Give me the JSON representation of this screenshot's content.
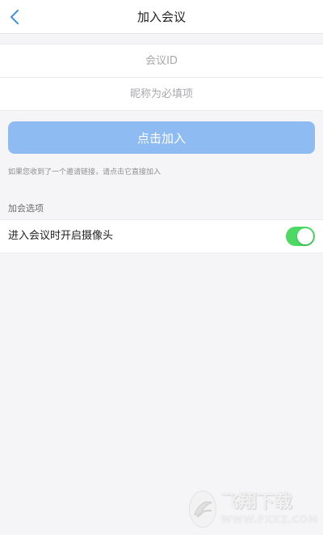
{
  "header": {
    "title": "加入会议",
    "back_icon": "chevron-left-icon"
  },
  "form": {
    "meeting_id": {
      "placeholder": "会议ID",
      "value": ""
    },
    "nickname": {
      "placeholder": "昵称为必填项",
      "value": ""
    },
    "join_button_label": "点击加入",
    "hint": "如果您收到了一个邀请链接，请点击它直接加入"
  },
  "options": {
    "section_title": "加会选项",
    "items": [
      {
        "label": "进入会议时开启摄像头",
        "enabled": true
      }
    ]
  },
  "watermark": {
    "title": "飞翔下载",
    "url": "WWW.FXXZ.COM"
  },
  "colors": {
    "accent_button": "#8fbbf3",
    "toggle_on": "#4cd964",
    "back_icon": "#4a90e2"
  }
}
